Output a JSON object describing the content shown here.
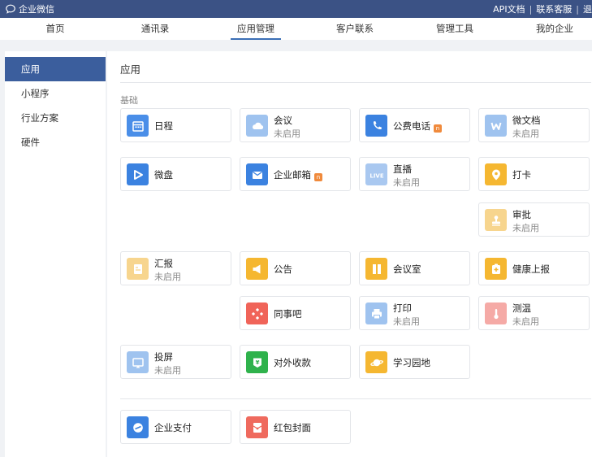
{
  "topbar": {
    "brand": "企业微信",
    "links": [
      "API文档",
      "联系客服",
      "退"
    ]
  },
  "nav": {
    "items": [
      "首页",
      "通讯录",
      "应用管理",
      "客户联系",
      "管理工具",
      "我的企业"
    ],
    "active_index": 2
  },
  "sidebar": {
    "items": [
      "应用",
      "小程序",
      "行业方案",
      "硬件"
    ],
    "active_index": 0
  },
  "panel": {
    "title": "应用",
    "section_label": "基础",
    "status_disabled": "未启用",
    "apps": [
      {
        "name": "日程",
        "icon": "calendar-icon",
        "color": "#4a8ee8"
      },
      {
        "name": "会议",
        "status": "未启用",
        "icon": "cloud-icon",
        "color": "#9fc3ef"
      },
      {
        "name": "公费电话",
        "icon": "phone-icon",
        "color": "#3b82e0",
        "badge": true
      },
      {
        "name": "微文档",
        "status": "未启用",
        "icon": "doc-w-icon",
        "color": "#9fc3ef"
      },
      {
        "name": "微盘",
        "icon": "drive-icon",
        "color": "#3b82e0"
      },
      {
        "name": "企业邮箱",
        "icon": "mail-icon",
        "color": "#3b82e0",
        "badge": true
      },
      {
        "name": "直播",
        "status": "未启用",
        "icon": "live-icon",
        "color": "#a9c8f0"
      },
      {
        "name": "打卡",
        "icon": "location-icon",
        "color": "#f5b731"
      },
      {
        "name": "审批",
        "status": "未启用",
        "icon": "stamp-icon",
        "color": "#f7d58e"
      },
      {
        "name": "汇报",
        "status": "未启用",
        "icon": "report-icon",
        "color": "#f7d58e"
      },
      {
        "name": "公告",
        "icon": "megaphone-icon",
        "color": "#f5b731"
      },
      {
        "name": "会议室",
        "icon": "door-icon",
        "color": "#f5b731"
      },
      {
        "name": "健康上报",
        "icon": "health-icon",
        "color": "#f5b731"
      },
      {
        "name": "同事吧",
        "icon": "network-icon",
        "color": "#f06459"
      },
      {
        "name": "打印",
        "status": "未启用",
        "icon": "printer-icon",
        "color": "#9fc3ef"
      },
      {
        "name": "测温",
        "status": "未启用",
        "icon": "thermometer-icon",
        "color": "#f5aaa6"
      },
      {
        "name": "投屏",
        "status": "未启用",
        "icon": "screen-cast-icon",
        "color": "#9fc3ef"
      },
      {
        "name": "对外收款",
        "icon": "yuan-icon",
        "color": "#2fb24c"
      },
      {
        "name": "学习园地",
        "icon": "planet-icon",
        "color": "#f5b731"
      },
      {
        "name": "企业支付",
        "icon": "payment-icon",
        "color": "#3b82e0"
      },
      {
        "name": "红包封面",
        "icon": "red-envelope-icon",
        "color": "#ef6a5e"
      }
    ]
  }
}
